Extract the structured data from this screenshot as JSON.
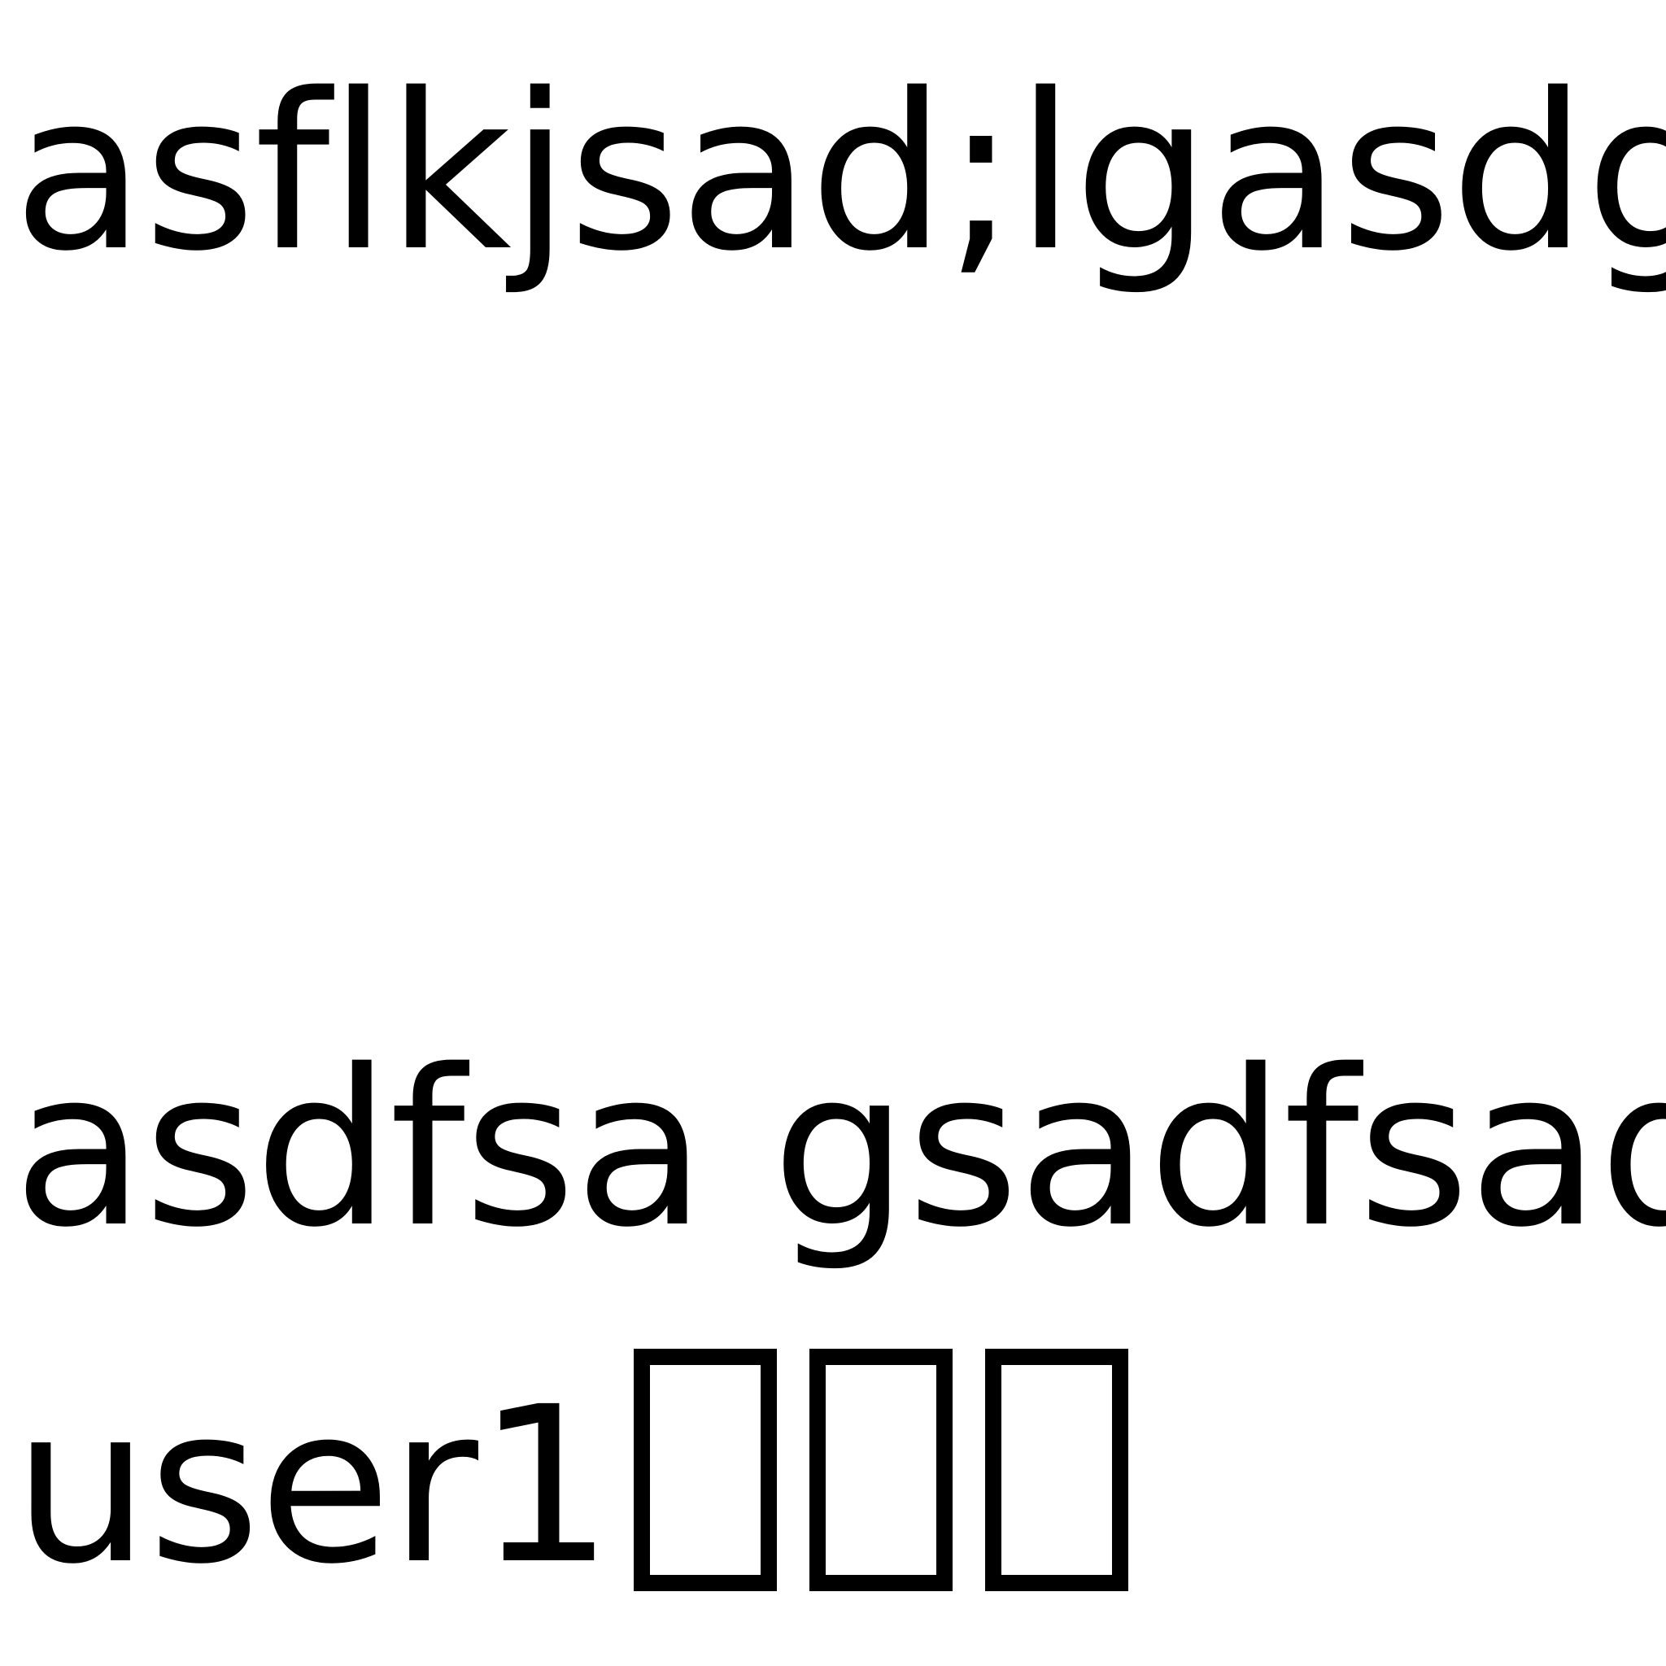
{
  "lines": {
    "line1": "asflkjsad;lgasdglkj",
    "line2": "asdfsa gsadfsadf",
    "line3_text": "user1",
    "line3_unrendered_glyph_count": 3
  },
  "colors": {
    "background": "#ffffff",
    "text": "#000000"
  }
}
